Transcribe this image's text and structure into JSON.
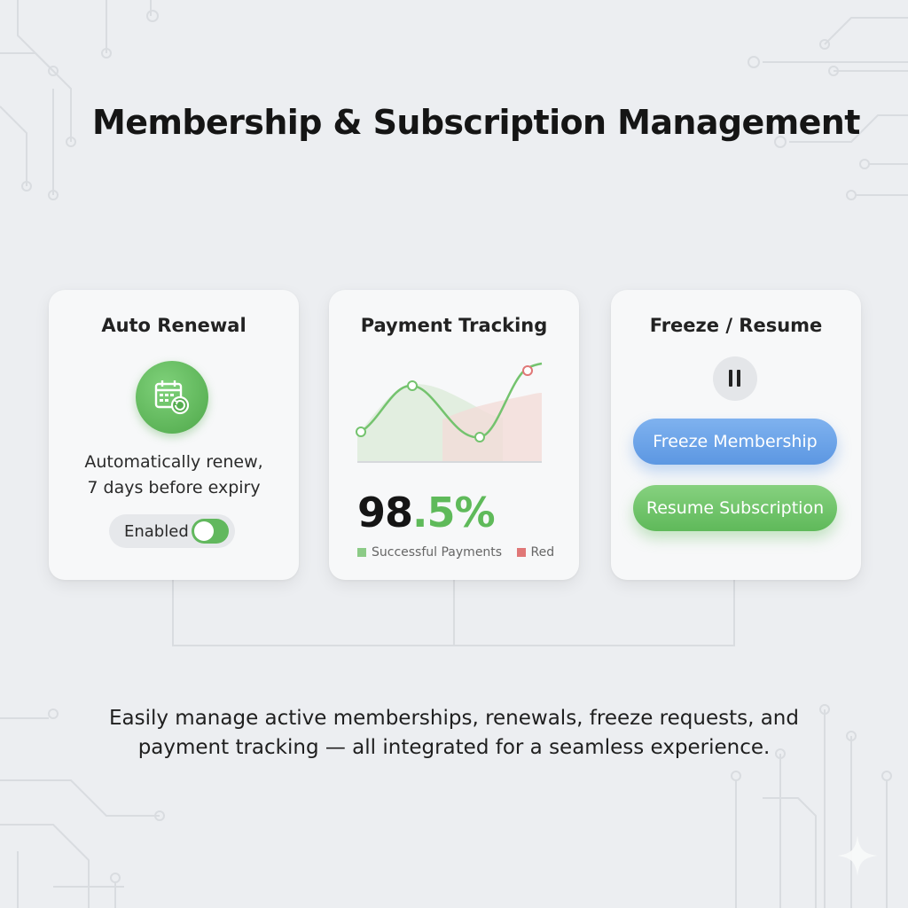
{
  "page": {
    "title": "Membership & Subscription Management",
    "footer_line1": "Easily manage active memberships, renewals, freeze requests, and",
    "footer_line2": "payment tracking — all integrated for a seamless experience."
  },
  "cards": {
    "auto_renewal": {
      "title": "Auto Renewal",
      "icon": "calendar-renew-icon",
      "description_line1": "Automatically renew,",
      "description_line2": "7 days before expiry",
      "toggle_label": "Enabled",
      "toggle_on": true
    },
    "payment_tracking": {
      "title": "Payment Tracking",
      "percent_int": "98",
      "percent_dec": ".5%",
      "legend_success": "Successful Payments",
      "legend_red": "Red"
    },
    "freeze_resume": {
      "title": "Freeze / Resume",
      "pause_icon": "pause-icon",
      "freeze_label": "Freeze Membership",
      "resume_label": "Resume Subscription"
    }
  },
  "colors": {
    "accent_green": "#5fba5a",
    "accent_blue": "#5c97e2",
    "accent_red": "#e07777",
    "background": "#eceef1"
  }
}
